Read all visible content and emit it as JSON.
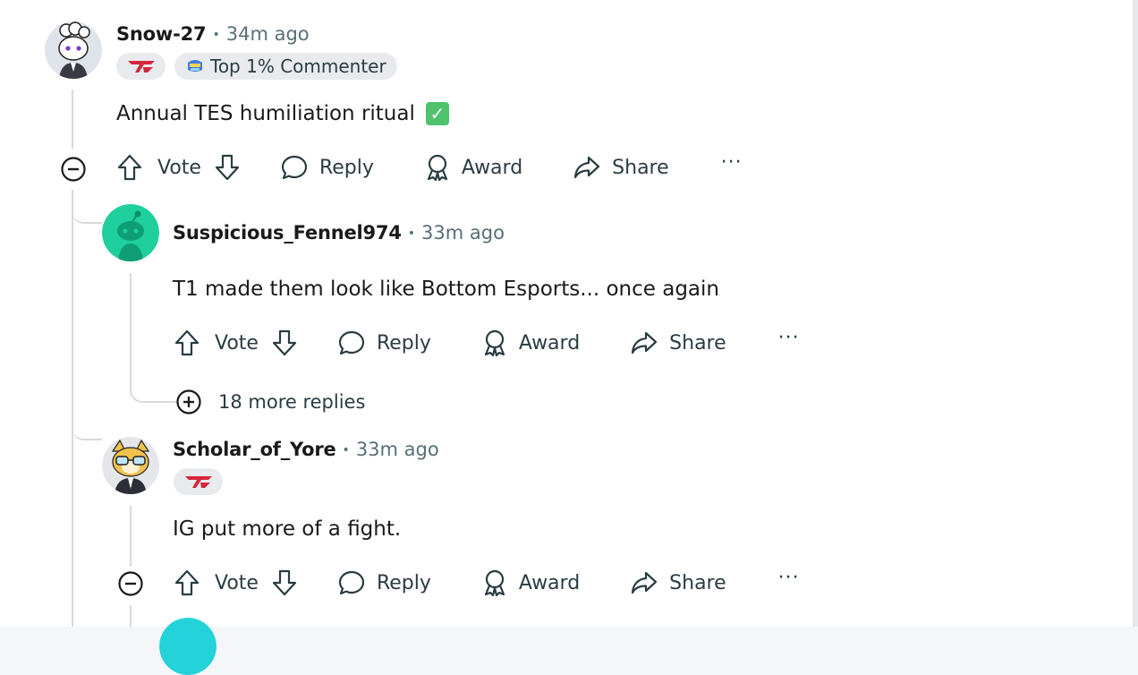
{
  "comments": [
    {
      "username": "Snow-27",
      "time": "34m ago",
      "flairs": [
        {
          "type": "team-logo",
          "text": ""
        },
        {
          "type": "text",
          "text": "Top 1% Commenter"
        }
      ],
      "body": "Annual TES humiliation ritual",
      "body_emoji": "✓"
    },
    {
      "username": "Suspicious_Fennel974",
      "time": "33m ago",
      "body": "T1 made them look like Bottom Esports... once again",
      "more_replies": "18 more replies"
    },
    {
      "username": "Scholar_of_Yore",
      "time": "33m ago",
      "flairs": [
        {
          "type": "team-logo",
          "text": ""
        }
      ],
      "body": "IG put more of a fight."
    }
  ],
  "actions": {
    "vote": "Vote",
    "reply": "Reply",
    "award": "Award",
    "share": "Share",
    "more": "···"
  },
  "colors": {
    "accent_red": "#d6263c",
    "green_avatar": "#1fcf9d",
    "muted_text": "#576f76",
    "thread_line": "#d7dadc"
  }
}
